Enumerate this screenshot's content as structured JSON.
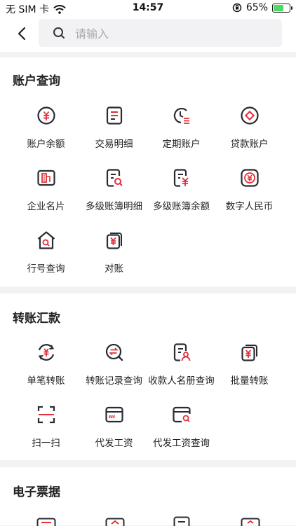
{
  "status_bar": {
    "carrier": "无 SIM 卡",
    "time": "14:57",
    "battery": "65%",
    "battery_level": 0.65
  },
  "search": {
    "placeholder": "请输入"
  },
  "colors": {
    "accent": "#e0303a",
    "icon_dark": "#2b2b36"
  },
  "sections": [
    {
      "title": "账户查询",
      "items": [
        {
          "label": "账户余额",
          "icon": "yuan-circle-icon"
        },
        {
          "label": "交易明细",
          "icon": "document-list-icon"
        },
        {
          "label": "定期账户",
          "icon": "clock-list-icon"
        },
        {
          "label": "贷款账户",
          "icon": "diamond-circle-icon"
        },
        {
          "label": "企业名片",
          "icon": "business-card-icon"
        },
        {
          "label": "多级账簿明细",
          "icon": "ledger-search-icon"
        },
        {
          "label": "多级账簿余额",
          "icon": "ledger-yuan-icon"
        },
        {
          "label": "数字人民币",
          "icon": "digital-yuan-icon"
        },
        {
          "label": "行号查询",
          "icon": "bank-search-icon"
        },
        {
          "label": "对账",
          "icon": "reconcile-icon"
        }
      ]
    },
    {
      "title": "转账汇款",
      "items": [
        {
          "label": "单笔转账",
          "icon": "yuan-transfer-icon"
        },
        {
          "label": "转账记录查询",
          "icon": "transfer-record-icon"
        },
        {
          "label": "收款人名册查询",
          "icon": "payee-roster-icon"
        },
        {
          "label": "批量转账",
          "icon": "batch-transfer-icon"
        },
        {
          "label": "扫一扫",
          "icon": "scan-icon"
        },
        {
          "label": "代发工资",
          "icon": "payroll-icon"
        },
        {
          "label": "代发工资查询",
          "icon": "payroll-search-icon"
        }
      ]
    },
    {
      "title": "电子票据",
      "items": []
    }
  ]
}
